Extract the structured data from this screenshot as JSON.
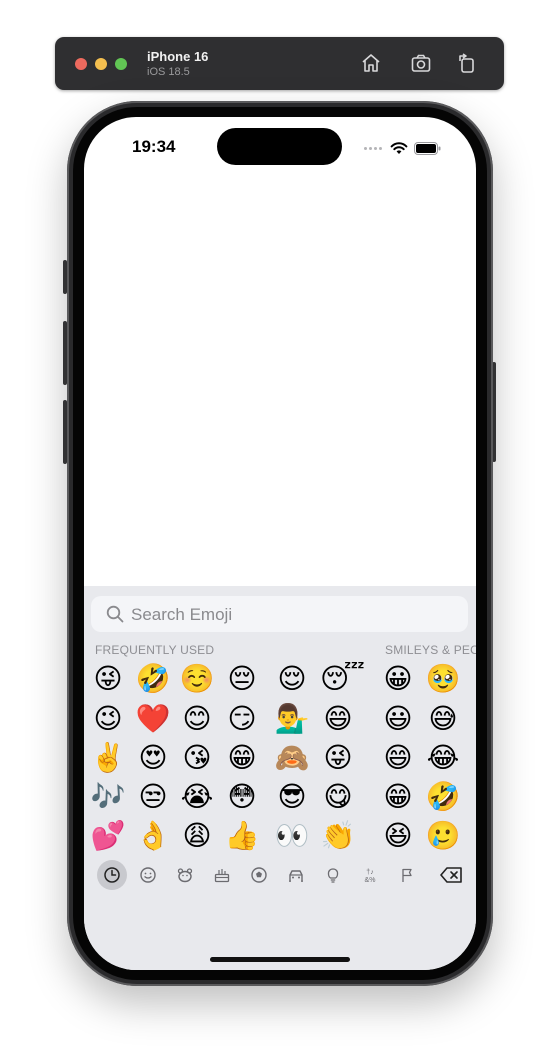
{
  "window": {
    "device_name": "iPhone 16",
    "os_version": "iOS 18.5",
    "toolbar_icons": [
      "home-icon",
      "screenshot-icon",
      "rotate-icon"
    ]
  },
  "status_bar": {
    "time": "19:34",
    "icons": [
      "cellular-dots-icon",
      "wifi-icon",
      "battery-icon"
    ]
  },
  "keyboard": {
    "search_placeholder": "Search Emoji",
    "sections": {
      "frequent_label": "FREQUENTLY USED",
      "smileys_label": "SMILEYS & PEO"
    },
    "frequent_emojis": [
      [
        "😜",
        "🤣",
        "☺️",
        "😔",
        "😌",
        "😴"
      ],
      [
        "😉",
        "❤️",
        "😊",
        "😏",
        "💁‍♂️",
        "😄"
      ],
      [
        "✌️",
        "😍",
        "😘",
        "😁",
        "🙈",
        "😜"
      ],
      [
        "🎶",
        "😒",
        "😭",
        "😳",
        "😎",
        "😋"
      ],
      [
        "💕",
        "👌",
        "😩",
        "👍",
        "👀",
        "👏"
      ]
    ],
    "smileys_emojis": [
      [
        "😀",
        "🥹"
      ],
      [
        "😃",
        "😅"
      ],
      [
        "😄",
        "😂"
      ],
      [
        "😁",
        "🤣"
      ],
      [
        "😆",
        "🥲"
      ]
    ],
    "categories": [
      {
        "icon": "clock-icon",
        "active": true
      },
      {
        "icon": "smiley-icon",
        "active": false
      },
      {
        "icon": "animal-icon",
        "active": false
      },
      {
        "icon": "food-icon",
        "active": false
      },
      {
        "icon": "ball-icon",
        "active": false
      },
      {
        "icon": "car-icon",
        "active": false
      },
      {
        "icon": "lightbulb-icon",
        "active": false
      },
      {
        "icon": "symbols-icon",
        "active": false
      },
      {
        "icon": "flag-icon",
        "active": false
      },
      {
        "icon": "delete-icon",
        "active": false
      }
    ],
    "symbols_text": "&%"
  }
}
